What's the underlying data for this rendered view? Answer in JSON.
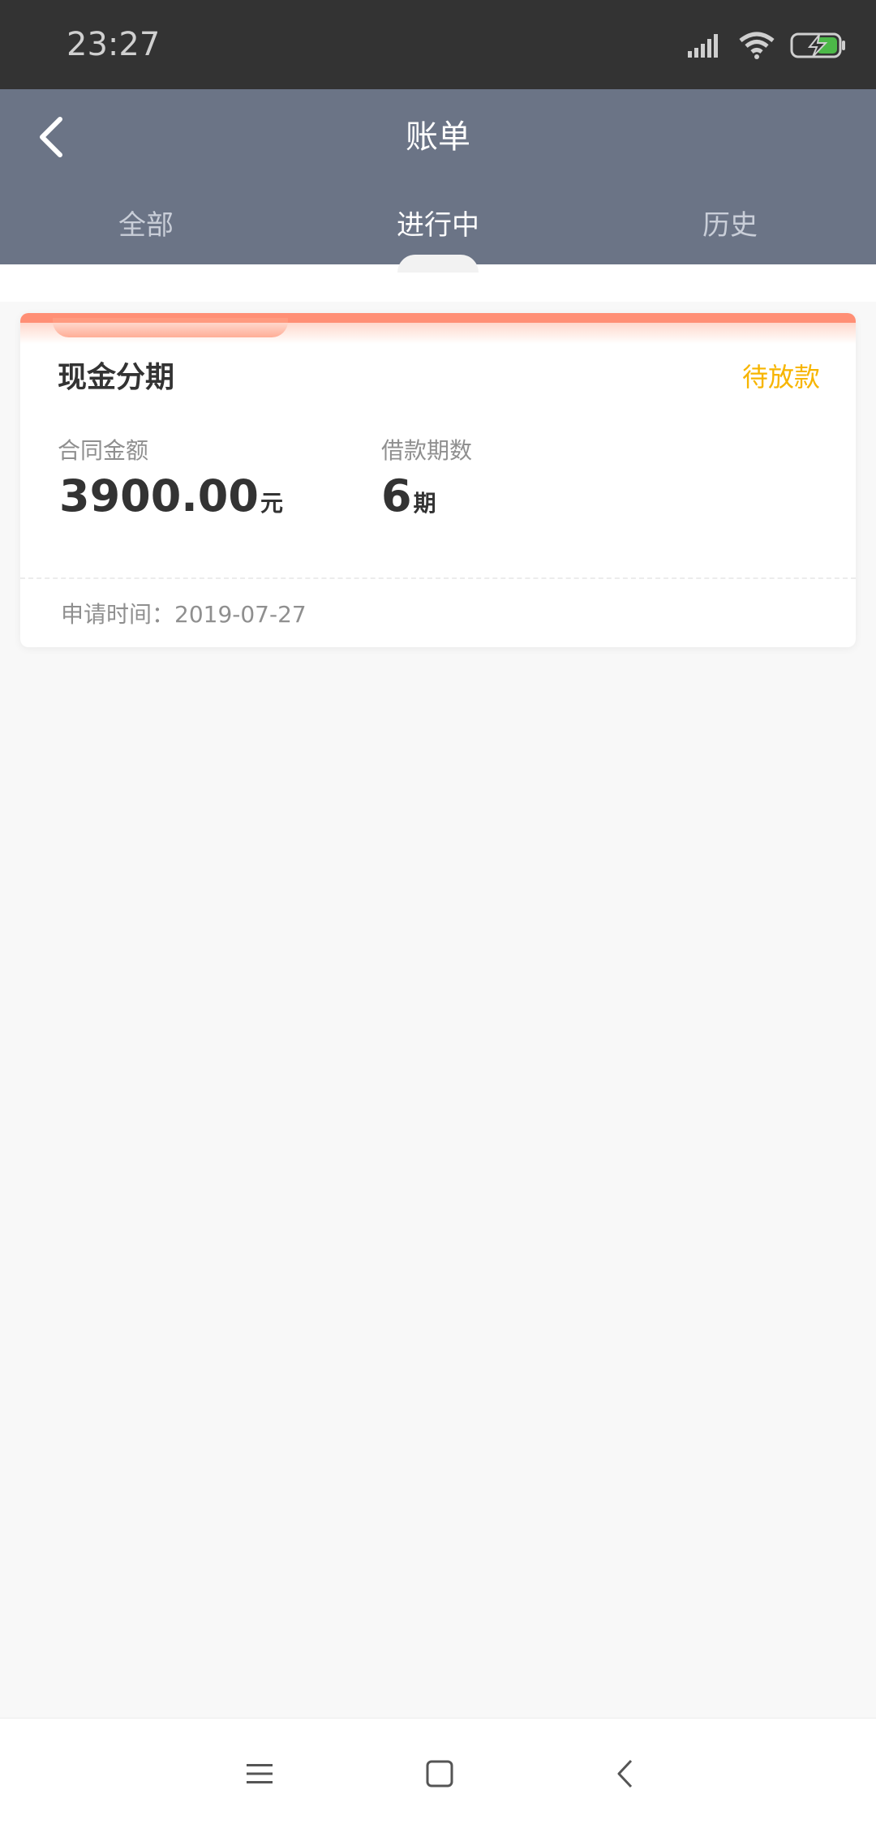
{
  "status_bar": {
    "time": "23:27",
    "icons": [
      "signal-icon",
      "wifi-icon",
      "battery-charging-icon"
    ]
  },
  "header": {
    "title": "账单",
    "back_icon": "back-arrow-icon"
  },
  "tabs": [
    {
      "label": "全部",
      "active": false
    },
    {
      "label": "进行中",
      "active": true
    },
    {
      "label": "历史",
      "active": false
    }
  ],
  "card": {
    "product": "现金分期",
    "status": "待放款",
    "amount_label": "合同金额",
    "amount_value": "3900.00",
    "amount_unit": "元",
    "periods_label": "借款期数",
    "periods_value": "6",
    "periods_unit": "期",
    "apply_time": "申请时间：2019-07-27"
  },
  "nav_bar": {
    "icons": [
      "menu-icon",
      "home-icon",
      "back-icon"
    ]
  },
  "colors": {
    "header_bg": "#6b7486",
    "accent_orange": "#ff8f75",
    "status_yellow": "#f7b500"
  }
}
